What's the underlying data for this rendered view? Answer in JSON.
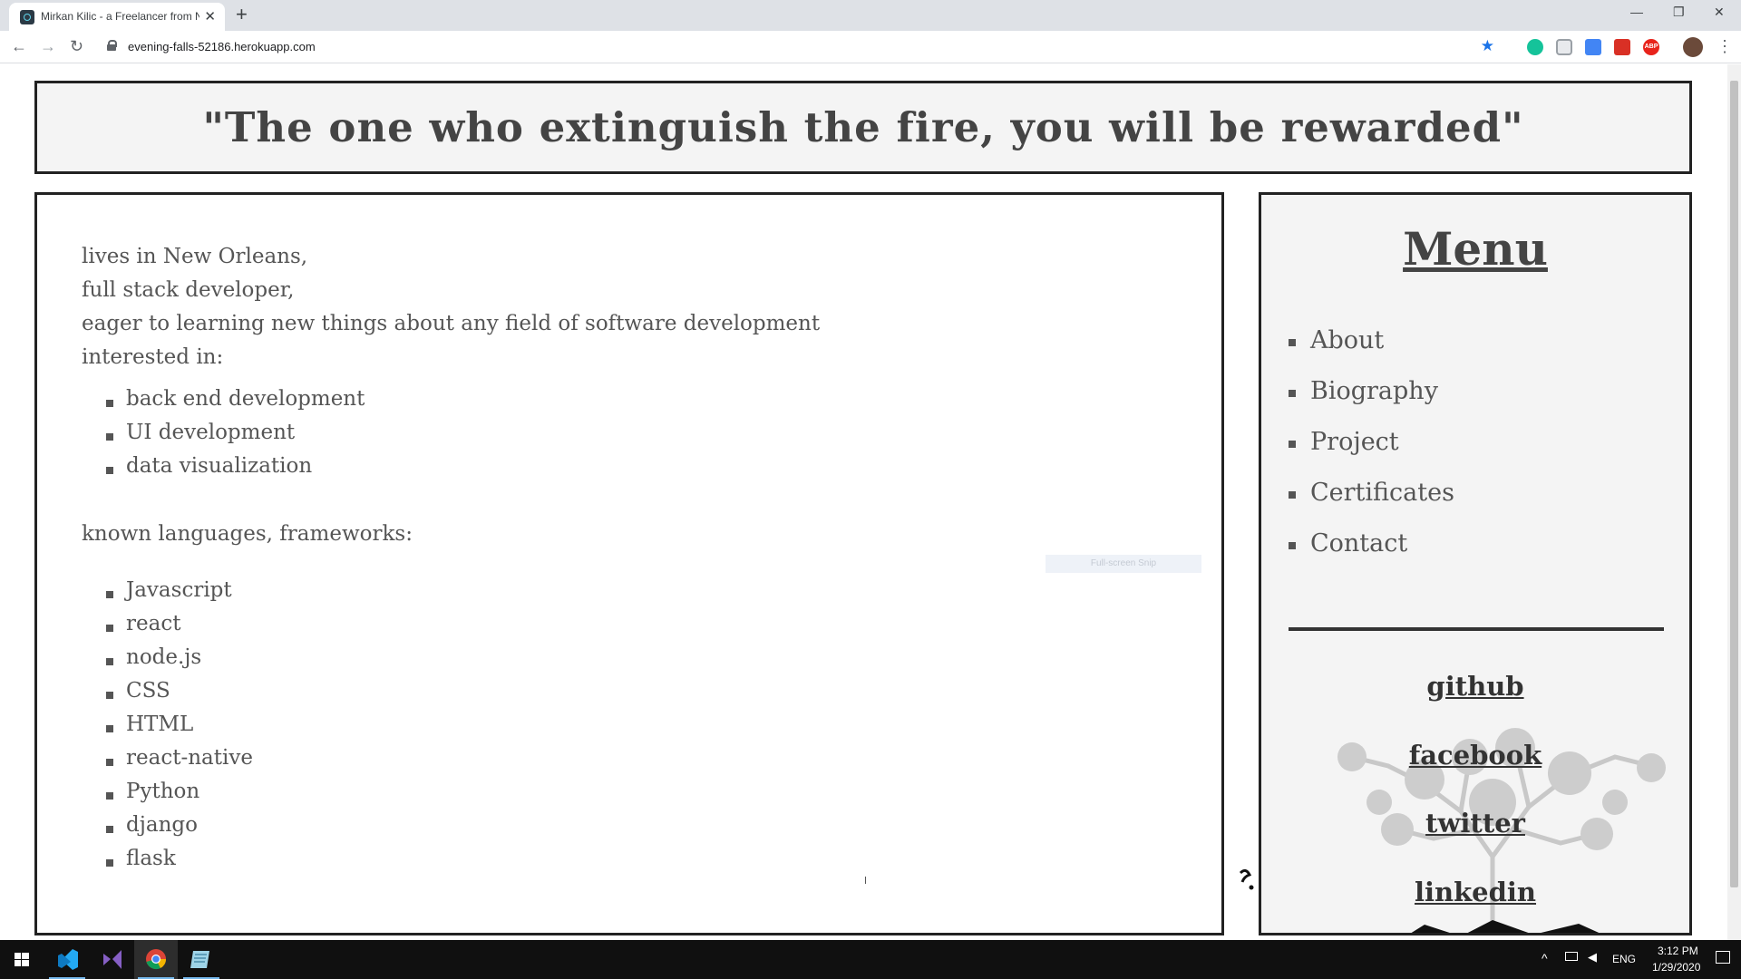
{
  "browser": {
    "tab_title": "Mirkan Kilic - a Freelancer from New Orleans",
    "tab_close": "✕",
    "new_tab": "+",
    "url": "evening-falls-52186.herokuapp.com",
    "window_controls": {
      "minimize": "—",
      "restore": "❐",
      "close": "✕"
    },
    "nav": {
      "back": "←",
      "forward": "→",
      "reload": "↻"
    },
    "bookmark_star": "★",
    "menu": "⋮",
    "extensions": [
      {
        "name": "grammarly-icon",
        "color": "#15c39a"
      },
      {
        "name": "shield-icon",
        "color": "#9aa0a6"
      },
      {
        "name": "translate-icon",
        "color": "#4285f4"
      },
      {
        "name": "pdf-icon",
        "color": "#d93025"
      },
      {
        "name": "adblock-icon",
        "color": "#e8231b",
        "label": "ABP"
      },
      {
        "name": "profile-avatar",
        "color": "#6b4a3a"
      }
    ]
  },
  "quote": "\"The one who extinguish the fire, you will be rewarded\"",
  "about": {
    "intro_lines": [
      "lives in New Orleans,",
      "full stack developer,",
      "eager to learning new things about any field of software development",
      "interested in:"
    ],
    "interests": [
      "back end development",
      "UI development",
      "data visualization"
    ],
    "languages_heading": "known languages, frameworks:",
    "languages": [
      "Javascript",
      "react",
      "node.js",
      "CSS",
      "HTML",
      "react-native",
      "Python",
      "django",
      "flask"
    ],
    "snip_tooltip": "Full-screen Snip"
  },
  "menu": {
    "title": "Menu",
    "items": [
      "About",
      "Biography",
      "Project",
      "Certificates",
      "Contact"
    ],
    "social": [
      "github",
      "facebook",
      "twitter",
      "linkedin"
    ]
  },
  "taskbar": {
    "apps": [
      {
        "name": "start-button",
        "color": "#ffffff"
      },
      {
        "name": "vscode-icon",
        "color": "#23a9f2"
      },
      {
        "name": "visual-studio-icon",
        "color": "#865fc5"
      },
      {
        "name": "chrome-icon",
        "color": "#f4b400"
      },
      {
        "name": "notepad-icon",
        "color": "#9ed4e8"
      }
    ],
    "language": "ENG",
    "time": "3:12 PM",
    "date": "1/29/2020",
    "tray_up": "^"
  }
}
